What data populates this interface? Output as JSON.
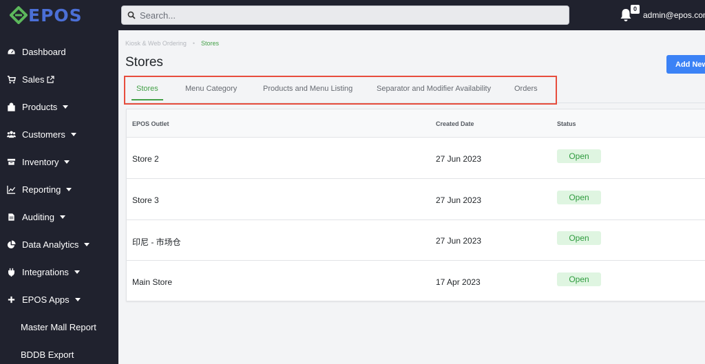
{
  "app": {
    "logo_text": "EPOS",
    "brand_color": "#4b6fd6",
    "logo_accent": "#5cb85c"
  },
  "topbar": {
    "search_placeholder": "Search...",
    "notification_count": "0",
    "user_email": "admin@epos.com.s"
  },
  "sidebar": {
    "items": [
      {
        "label": "Dashboard",
        "icon": "dashboard-icon",
        "has_caret": false
      },
      {
        "label": "Sales",
        "icon": "cart-icon",
        "has_caret": false,
        "external": true
      },
      {
        "label": "Products",
        "icon": "bag-icon",
        "has_caret": true
      },
      {
        "label": "Customers",
        "icon": "users-icon",
        "has_caret": true
      },
      {
        "label": "Inventory",
        "icon": "box-icon",
        "has_caret": true
      },
      {
        "label": "Reporting",
        "icon": "chart-icon",
        "has_caret": true
      },
      {
        "label": "Auditing",
        "icon": "file-icon",
        "has_caret": true
      },
      {
        "label": "Data Analytics",
        "icon": "pie-icon",
        "has_caret": true
      },
      {
        "label": "Integrations",
        "icon": "plug-icon",
        "has_caret": true
      },
      {
        "label": "EPOS Apps",
        "icon": "plus-icon",
        "has_caret": true
      },
      {
        "label": "Master Mall Report",
        "icon": "",
        "has_caret": false
      },
      {
        "label": "BDDB Export",
        "icon": "",
        "has_caret": false
      }
    ]
  },
  "breadcrumb": {
    "parent": "Kiosk & Web Ordering",
    "separator": "•",
    "current": "Stores"
  },
  "page": {
    "title": "Stores",
    "add_button": "Add New"
  },
  "tabs": [
    {
      "label": "Stores",
      "active": true
    },
    {
      "label": "Menu Category",
      "active": false
    },
    {
      "label": "Products and Menu Listing",
      "active": false
    },
    {
      "label": "Separator and Modifier Availability",
      "active": false
    },
    {
      "label": "Orders",
      "active": false
    }
  ],
  "table": {
    "columns": [
      "EPOS Outlet",
      "Created Date",
      "Status"
    ],
    "rows": [
      {
        "outlet": "Store 2",
        "created": "27 Jun 2023",
        "status": "Open"
      },
      {
        "outlet": "Store 3",
        "created": "27 Jun 2023",
        "status": "Open"
      },
      {
        "outlet": "印尼 - 市场仓",
        "created": "27 Jun 2023",
        "status": "Open"
      },
      {
        "outlet": "Main Store",
        "created": "17 Apr 2023",
        "status": "Open"
      }
    ]
  },
  "colors": {
    "sidebar_bg": "#20222e",
    "accent_green": "#43a047",
    "primary_blue": "#3b82f6",
    "highlight_red": "#e74c3c"
  }
}
